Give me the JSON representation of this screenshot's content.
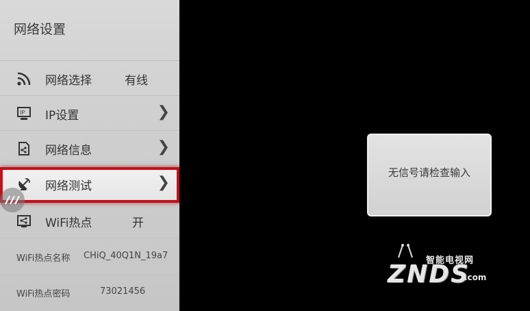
{
  "panel": {
    "title": "网络设置",
    "items": [
      {
        "label": "网络选择",
        "value": "有线",
        "icon": "rss-icon",
        "chevron": false
      },
      {
        "label": "IP设置",
        "value": "",
        "icon": "monitor-icon",
        "chevron": true
      },
      {
        "label": "网络信息",
        "value": "",
        "icon": "document-icon",
        "chevron": true
      },
      {
        "label": "网络测试",
        "value": "",
        "icon": "satellite-dish-icon",
        "chevron": true,
        "focused": true
      },
      {
        "label": "WiFi热点",
        "value": "开",
        "icon": "share-icon",
        "chevron": false
      }
    ],
    "details": [
      {
        "label": "WiFi热点名称",
        "value": "CHiQ_40Q1N_19a7"
      },
      {
        "label": "WiFi热点密码",
        "value": "73021456"
      }
    ]
  },
  "dialog": {
    "message": "无信号请检查输入"
  },
  "watermark": {
    "tagline": "智能电视网",
    "brand": "ZNDS",
    "domain": ".com"
  },
  "colors": {
    "focus_border": "#c0111b",
    "background": "#000000"
  }
}
